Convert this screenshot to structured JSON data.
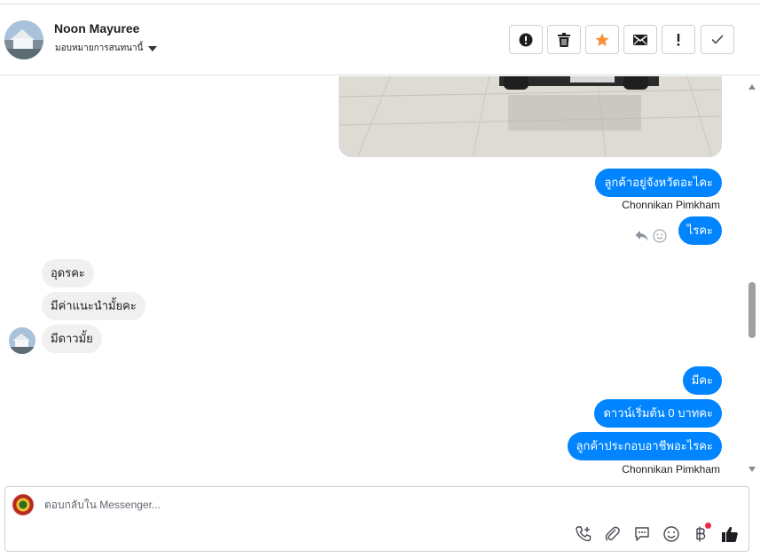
{
  "header": {
    "contact_name": "Noon Mayuree",
    "assign_label": "มอบหมายการสนทนานี้",
    "actions": [
      {
        "name": "spam",
        "icon": "exclamation-circle-icon"
      },
      {
        "name": "delete",
        "icon": "trash-icon"
      },
      {
        "name": "star",
        "icon": "star-icon"
      },
      {
        "name": "mark-unread",
        "icon": "envelope-icon"
      },
      {
        "name": "follow-up",
        "icon": "exclamation-icon"
      },
      {
        "name": "done",
        "icon": "check-icon"
      }
    ]
  },
  "messages": {
    "m1": "ลูกค้าอยู่จังหวัดอะไคะ",
    "m1_sender": "Chonnikan Pimkham",
    "m2": "ไรคะ",
    "m3": "อุดรคะ",
    "m4": "มีค่าแนะนำมั้ยคะ",
    "m5": "มีดาวมั้ย",
    "m6": "มีคะ",
    "m7": "ดาวน์เริ่มต้น 0 บาทคะ",
    "m8": "ลูกค้าประกอบอาชีพอะไรคะ",
    "m8_sender": "Chonnikan Pimkham"
  },
  "composer": {
    "placeholder": "ตอบกลับใน Messenger..."
  },
  "colors": {
    "outgoing": "#0084ff",
    "incoming": "#f0f0f0",
    "star": "#f7923a",
    "notification_dot": "#f02849"
  }
}
